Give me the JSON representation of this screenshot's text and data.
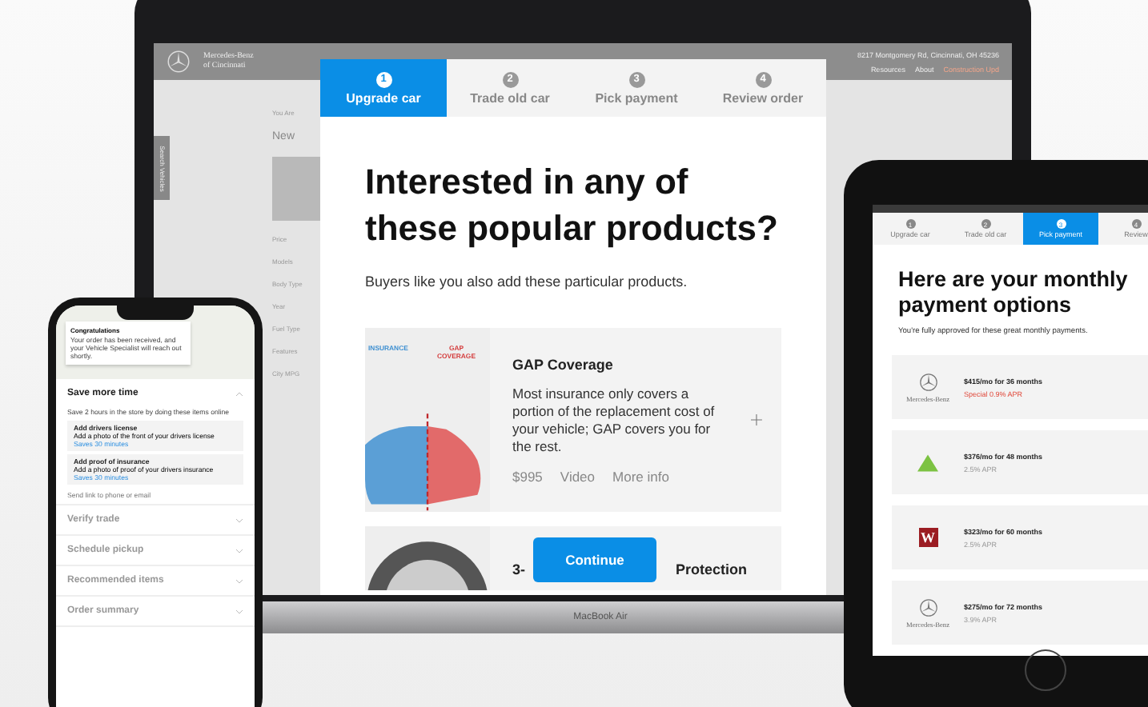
{
  "laptop": {
    "site": {
      "brand": "Mercedes-Benz",
      "location": "of Cincinnati",
      "address": "8217 Montgomery Rd, Cincinnati, OH 45236",
      "nav": [
        "Resources",
        "About",
        "Construction Upd"
      ],
      "side_tab": "Search Vehicles",
      "breadcrumb": "You Are",
      "heading": "New",
      "filters": [
        "Price",
        "Models",
        "Body Type",
        "Year",
        "Fuel Type",
        "Features",
        "City MPG"
      ]
    },
    "modal": {
      "steps": [
        {
          "number": "1",
          "label": "Upgrade car",
          "selected": true
        },
        {
          "number": "2",
          "label": "Trade old car",
          "selected": false
        },
        {
          "number": "3",
          "label": "Pick payment",
          "selected": false
        },
        {
          "number": "4",
          "label": "Review order",
          "selected": false
        }
      ],
      "title": "Interested in any of these popular products?",
      "subtitle": "Buyers like you also add these particular products.",
      "products": [
        {
          "kind": "gap",
          "image_labels": [
            "INSURANCE",
            "GAP COVERAGE"
          ],
          "title": "GAP Coverage",
          "description": "Most insurance only covers a portion of the replacement cost of your vehicle; GAP covers you for the rest.",
          "price": "$995",
          "links": [
            "Video",
            "More info"
          ]
        },
        {
          "kind": "tire",
          "title_parts": [
            "3-",
            "Protection"
          ]
        }
      ],
      "continue_button": "Continue"
    },
    "device_label": "MacBook Air"
  },
  "tablet": {
    "steps": [
      {
        "number": "1",
        "label": "Upgrade car",
        "selected": false
      },
      {
        "number": "2",
        "label": "Trade old car",
        "selected": false
      },
      {
        "number": "3",
        "label": "Pick payment",
        "selected": true
      },
      {
        "number": "4",
        "label": "Review",
        "selected": false
      }
    ],
    "title": "Here are your monthly payment options",
    "subtitle": "You're fully approved for these great monthly payments.",
    "options": [
      {
        "kind": "mercedes",
        "lender": "Mercedes-Benz",
        "term": "$415/mo for 36 months",
        "rate": "Special 0.9% APR",
        "special": true
      },
      {
        "kind": "leaf",
        "term": "$376/mo for 48 months",
        "rate": "2.5% APR",
        "special": false
      },
      {
        "kind": "badge",
        "badge": "W",
        "term": "$323/mo for 60 months",
        "rate": "2.5% APR",
        "special": false
      },
      {
        "kind": "mercedes",
        "lender": "Mercedes-Benz",
        "term": "$275/mo for 72 months",
        "rate": "3.9% APR",
        "special": false
      }
    ]
  },
  "phone": {
    "notice": {
      "title": "Congratulations",
      "text": "Your order has been received, and your Vehicle Specialist will reach out shortly."
    },
    "sections": [
      {
        "title": "Save more time",
        "expanded": true,
        "subtitle": "Save 2 hours in the store by doing these items online",
        "tasks": [
          {
            "title": "Add drivers license",
            "text": "Add a photo of the front of your drivers license",
            "saves": "Saves 30 minutes"
          },
          {
            "title": "Add proof of insurance",
            "text": "Add a photo of proof of your drivers insurance",
            "saves": "Saves 30 minutes"
          }
        ],
        "link": "Send link to phone or email"
      },
      {
        "title": "Verify trade",
        "expanded": false
      },
      {
        "title": "Schedule pickup",
        "expanded": false
      },
      {
        "title": "Recommended items",
        "expanded": false
      },
      {
        "title": "Order summary",
        "expanded": false
      }
    ]
  }
}
